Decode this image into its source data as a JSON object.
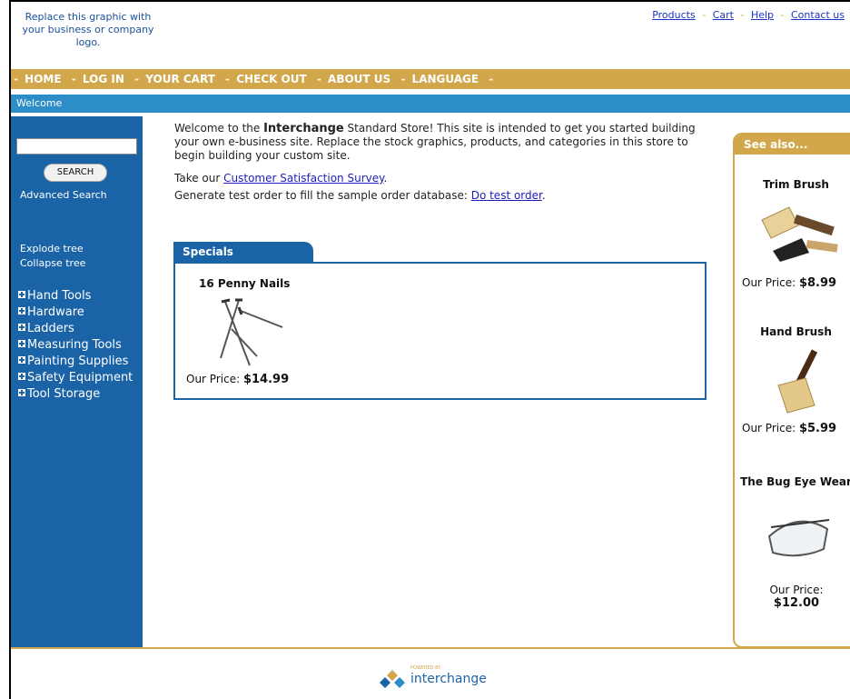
{
  "logo": {
    "placeholder_text": "Replace this graphic with your business or company logo."
  },
  "top_links": [
    "Products",
    "Cart",
    "Help",
    "Contact us"
  ],
  "top_links_separator": "-",
  "navbar": {
    "items": [
      "HOME",
      "LOG IN",
      "YOUR CART",
      "CHECK OUT",
      "ABOUT US",
      "LANGUAGE"
    ],
    "separator": "-"
  },
  "welcome_bar": {
    "text": "Welcome"
  },
  "sidebar": {
    "search_button": "SEARCH",
    "advanced_search": "Advanced Search",
    "explode_tree": "Explode tree",
    "collapse_tree": "Collapse tree",
    "categories": [
      "Hand Tools",
      "Hardware",
      "Ladders",
      "Measuring Tools",
      "Painting Supplies",
      "Safety Equipment",
      "Tool Storage"
    ]
  },
  "main": {
    "intro_before": "Welcome to the ",
    "intro_brand": "Interchange",
    "intro_after": " Standard Store! This site is intended to get you started building your own e-business site. Replace the stock graphics, products, and categories in this store to begin building your custom site.",
    "survey_prefix": "Take our ",
    "survey_link": "Customer Satisfaction Survey",
    "survey_suffix": ".",
    "test_prefix": "Generate test order to fill the sample order database: ",
    "test_link": "Do test order",
    "test_suffix": "."
  },
  "specials": {
    "title": "Specials",
    "product_name": "16 Penny Nails",
    "price_label": "Our Price:",
    "price": "$14.99"
  },
  "see_also": {
    "title": "See also...",
    "items": [
      {
        "name": "Trim Brush",
        "price_label": "Our Price:",
        "price": "$8.99"
      },
      {
        "name": "Hand Brush",
        "price_label": "Our Price:",
        "price": "$5.99"
      },
      {
        "name": "The Bug Eye Wear",
        "price_label": "Our Price:",
        "price": "$12.00"
      }
    ]
  },
  "footer": {
    "powered_by": "POWERED BY",
    "brand": "interchange"
  },
  "colors": {
    "gold": "#d2a64a",
    "blue": "#1b63a7",
    "light_blue": "#2d8dc6"
  }
}
